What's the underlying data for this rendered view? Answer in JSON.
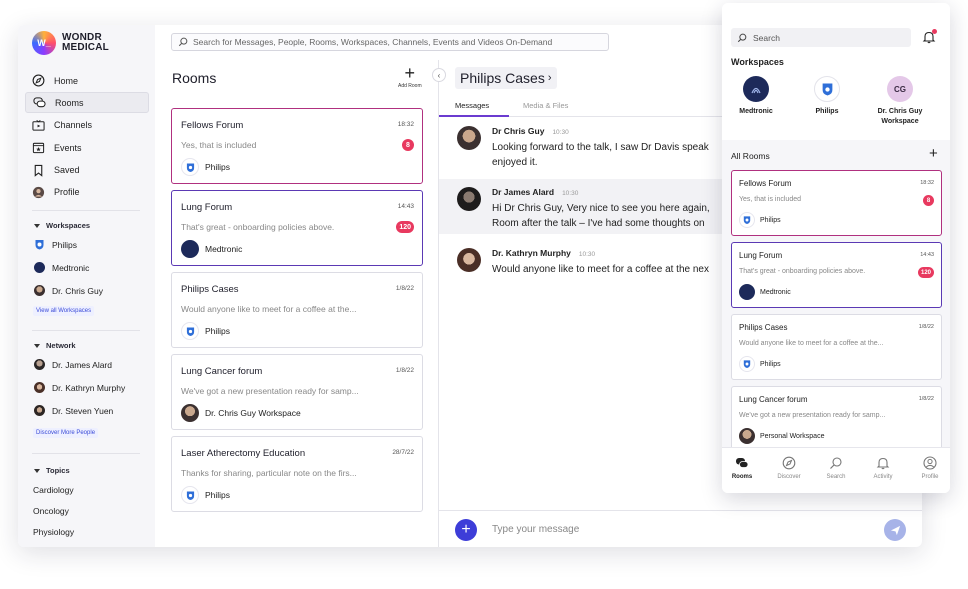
{
  "brand": {
    "logo_text": "W_",
    "name_line1": "WONDR",
    "name_line2": "MEDICAL"
  },
  "search": {
    "placeholder": "Search for Messages, People, Rooms, Workspaces, Channels, Events and Videos On-Demand"
  },
  "nav": [
    {
      "label": "Home",
      "icon": "compass-icon"
    },
    {
      "label": "Rooms",
      "icon": "chat-bubbles-icon",
      "active": true
    },
    {
      "label": "Channels",
      "icon": "tv-icon"
    },
    {
      "label": "Events",
      "icon": "calendar-star-icon"
    },
    {
      "label": "Saved",
      "icon": "bookmark-icon"
    },
    {
      "label": "Profile",
      "icon": "avatar-icon"
    }
  ],
  "workspaces_section": {
    "title": "Workspaces",
    "items": [
      {
        "label": "Philips"
      },
      {
        "label": "Medtronic"
      },
      {
        "label": "Dr. Chris Guy"
      }
    ],
    "link": "View all Workspaces"
  },
  "network_section": {
    "title": "Network",
    "items": [
      {
        "label": "Dr. James Alard"
      },
      {
        "label": "Dr. Kathryn Murphy"
      },
      {
        "label": "Dr. Steven Yuen"
      }
    ],
    "link": "Discover More People"
  },
  "topics_section": {
    "title": "Topics",
    "items": [
      {
        "label": "Cardiology"
      },
      {
        "label": "Oncology"
      },
      {
        "label": "Physiology"
      }
    ]
  },
  "rooms": {
    "title": "Rooms",
    "add_label": "Add Room",
    "cards": [
      {
        "name": "Fellows Forum",
        "time": "18:32",
        "preview": "Yes, that is included",
        "badge": "8",
        "workspace": "Philips"
      },
      {
        "name": "Lung Forum",
        "time": "14:43",
        "preview": "That's great - onboarding policies above.",
        "badge": "120",
        "workspace": "Medtronic"
      },
      {
        "name": "Philips Cases",
        "time": "1/8/22",
        "preview": "Would anyone like to meet for a coffee at the...",
        "badge": "",
        "workspace": "Philips"
      },
      {
        "name": "Lung Cancer forum",
        "time": "1/8/22",
        "preview": "We've got a new presentation ready for samp...",
        "badge": "",
        "workspace": "Dr. Chris Guy Workspace"
      },
      {
        "name": "Laser Atherectomy Education",
        "time": "28/7/22",
        "preview": "Thanks for sharing, particular note on the firs...",
        "badge": "",
        "workspace": "Philips"
      }
    ]
  },
  "chat": {
    "title": "Philips Cases",
    "title_chevron": "›",
    "tabs": [
      {
        "label": "Messages",
        "active": true
      },
      {
        "label": "Media & Files"
      }
    ],
    "messages": [
      {
        "author": "Dr Chris Guy",
        "time": "10:30",
        "text": "Looking forward to the talk, I saw Dr Davis speak enjoyed it."
      },
      {
        "author": "Dr James Alard",
        "time": "10:30",
        "text": "Hi Dr Chris Guy, Very nice to see you here again, Room after the talk – I've had some thoughts on"
      },
      {
        "author": "Dr. Kathryn Murphy",
        "time": "10:30",
        "text": "Would anyone like to meet for a coffee at the nex"
      }
    ],
    "composer_placeholder": "Type your message"
  },
  "mobile": {
    "search_placeholder": "Search",
    "workspaces_title": "Workspaces",
    "workspaces": [
      {
        "label": "Medtronic"
      },
      {
        "label": "Philips"
      },
      {
        "label": "Dr. Chris Guy Workspace",
        "initials": "CG"
      }
    ],
    "all_rooms_title": "All Rooms",
    "cards": [
      {
        "name": "Fellows Forum",
        "time": "18:32",
        "preview": "Yes, that is included",
        "badge": "8",
        "workspace": "Philips"
      },
      {
        "name": "Lung Forum",
        "time": "14:43",
        "preview": "That's great - onboarding policies above.",
        "badge": "120",
        "workspace": "Medtronic"
      },
      {
        "name": "Philips Cases",
        "time": "1/8/22",
        "preview": "Would anyone like to meet for a coffee at the...",
        "badge": "",
        "workspace": "Philips"
      },
      {
        "name": "Lung Cancer forum",
        "time": "1/8/22",
        "preview": "We've got a new presentation ready for samp...",
        "badge": "",
        "workspace": "Personal Workspace"
      }
    ],
    "bottom_nav": [
      {
        "label": "Rooms",
        "active": true
      },
      {
        "label": "Discover"
      },
      {
        "label": "Search"
      },
      {
        "label": "Activity"
      },
      {
        "label": "Profile"
      }
    ]
  },
  "colors": {
    "accent": "#3d3dd8",
    "badge": "#e8395f",
    "highlight_magenta": "#b0307f",
    "highlight_purple": "#5b39b4"
  }
}
